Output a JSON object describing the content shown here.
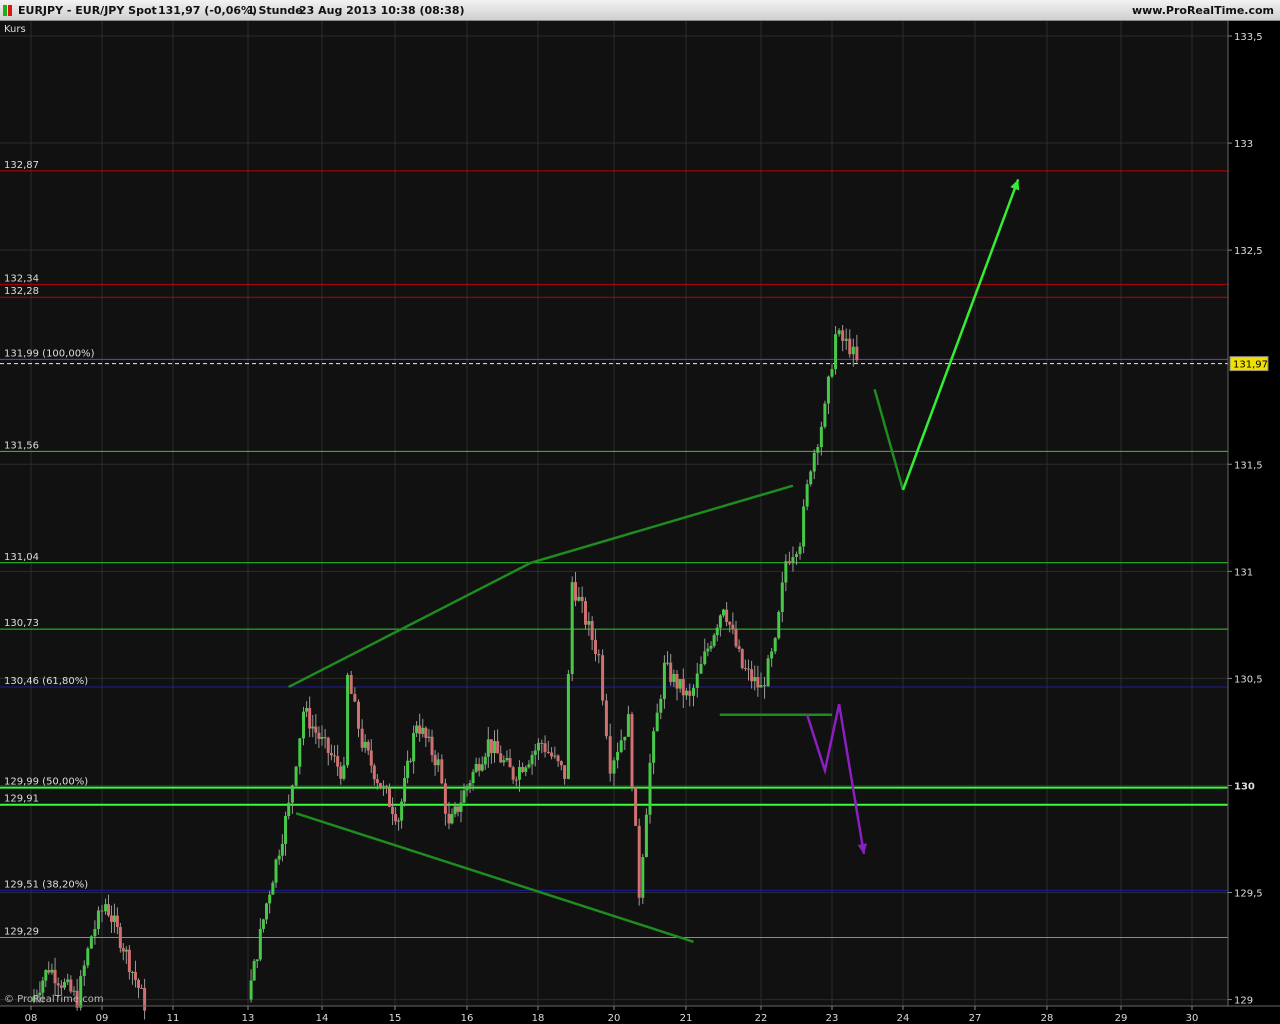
{
  "header": {
    "instrument": "EURJPY - EUR/JPY Spot",
    "quote": "131,97 (-0,06%)",
    "period": "1 Stunde",
    "datetime": "23 Aug 2013 10:38 (08:38)",
    "website": "www.ProRealTime.com",
    "indicator_colors": [
      "#19b319",
      "#e01414"
    ]
  },
  "chart_data": {
    "type": "candlestick",
    "title": "Kurs",
    "watermark": "© ProRealTime.com",
    "ylim": [
      128.97,
      133.57
    ],
    "y_ticks": [
      "133,5",
      "133",
      "132,5",
      "131,5",
      "131",
      "130,5",
      "130",
      "129,5",
      "129"
    ],
    "x_ticks": [
      {
        "label": "08",
        "x": 0
      },
      {
        "label": "09",
        "x": 1
      },
      {
        "label": "11",
        "x": 2
      },
      {
        "label": "13",
        "x": 3
      },
      {
        "label": "14",
        "x": 4
      },
      {
        "label": "15",
        "x": 5
      },
      {
        "label": "16",
        "x": 6
      },
      {
        "label": "18",
        "x": 7
      },
      {
        "label": "20",
        "x": 8
      },
      {
        "label": "21",
        "x": 9
      },
      {
        "label": "22",
        "x": 10
      },
      {
        "label": "23",
        "x": 11
      },
      {
        "label": "24",
        "x": 12
      },
      {
        "label": "27",
        "x": 13
      },
      {
        "label": "28",
        "x": 14
      },
      {
        "label": "29",
        "x": 15
      },
      {
        "label": "30",
        "x": 16
      }
    ],
    "current_price": {
      "value": 131.97,
      "label": "131,97",
      "color": "#f0e000"
    },
    "hlines": [
      {
        "value": 132.87,
        "label": "132,87",
        "color": "#c00000",
        "width": 1
      },
      {
        "value": 132.34,
        "label": "132,34",
        "color": "#c00000",
        "width": 1
      },
      {
        "value": 132.28,
        "label": "132,28",
        "color": "#c00000",
        "width": 1
      },
      {
        "value": 131.99,
        "label": "131,99 (100,00%)",
        "color": "#8a2be2",
        "width": 1
      },
      {
        "value": 131.56,
        "label": "131,56",
        "color": "#2ecc2e",
        "width": 1
      },
      {
        "value": 131.04,
        "label": "131,04",
        "color": "#2ecc2e",
        "width": 1
      },
      {
        "value": 130.73,
        "label": "130,73",
        "color": "#2ecc2e",
        "width": 1
      },
      {
        "value": 130.46,
        "label": "130,46 (61,80%)",
        "color": "#1c1ca0",
        "width": 1
      },
      {
        "value": 129.99,
        "label": "129,99 (50,00%)",
        "color": "#35ff35",
        "width": 2
      },
      {
        "value": 129.91,
        "label": "129,91",
        "color": "#35ff35",
        "width": 2
      },
      {
        "value": 129.51,
        "label": "129,51 (38,20%)",
        "color": "#1c1ca0",
        "width": 1
      },
      {
        "value": 129.29,
        "label": "129,29",
        "color": "#2ecc2e",
        "width": 1
      }
    ],
    "bold_tick": "130",
    "price_path": [
      [
        0.0,
        128.99
      ],
      [
        0.25,
        129.15
      ],
      [
        0.65,
        129.0
      ],
      [
        0.85,
        129.3
      ],
      [
        1.05,
        129.45
      ],
      [
        1.3,
        129.25
      ],
      [
        1.6,
        128.98
      ],
      [
        3.0,
        129.0
      ],
      [
        3.25,
        129.45
      ],
      [
        3.55,
        129.9
      ],
      [
        3.75,
        130.35
      ],
      [
        4.0,
        130.2
      ],
      [
        4.3,
        130.05
      ],
      [
        4.35,
        130.5
      ],
      [
        4.55,
        130.2
      ],
      [
        4.8,
        130.0
      ],
      [
        5.05,
        129.85
      ],
      [
        5.3,
        130.3
      ],
      [
        5.6,
        130.1
      ],
      [
        5.75,
        129.8
      ],
      [
        6.0,
        130.0
      ],
      [
        6.3,
        130.2
      ],
      [
        6.65,
        130.05
      ],
      [
        7.05,
        130.2
      ],
      [
        7.35,
        130.05
      ],
      [
        7.45,
        130.95
      ],
      [
        7.8,
        130.6
      ],
      [
        7.95,
        130.1
      ],
      [
        8.2,
        130.3
      ],
      [
        8.35,
        129.5
      ],
      [
        8.5,
        130.1
      ],
      [
        8.7,
        130.55
      ],
      [
        9.05,
        130.4
      ],
      [
        9.25,
        130.6
      ],
      [
        9.5,
        130.85
      ],
      [
        9.75,
        130.55
      ],
      [
        10.0,
        130.45
      ],
      [
        10.2,
        130.65
      ],
      [
        10.35,
        131.05
      ],
      [
        10.55,
        131.15
      ],
      [
        10.7,
        131.5
      ],
      [
        10.9,
        131.75
      ],
      [
        11.05,
        132.1
      ],
      [
        11.25,
        132.05
      ],
      [
        11.35,
        131.97
      ]
    ],
    "drawings": [
      {
        "kind": "trend",
        "color": "#1e8c1e",
        "points": [
          [
            3.55,
            130.46
          ],
          [
            6.9,
            131.04
          ],
          [
            10.45,
            131.4
          ]
        ]
      },
      {
        "kind": "trend",
        "color": "#1e8c1e",
        "points": [
          [
            3.65,
            129.87
          ],
          [
            9.1,
            129.27
          ]
        ]
      },
      {
        "kind": "segment",
        "color": "#1e8c1e",
        "points": [
          [
            9.45,
            130.33
          ],
          [
            11.0,
            130.33
          ]
        ]
      },
      {
        "kind": "zigzag",
        "color": "#1e8c1e",
        "points": [
          [
            11.6,
            131.85
          ],
          [
            12.0,
            131.38
          ]
        ]
      },
      {
        "kind": "arrow",
        "color": "#33ee33",
        "points": [
          [
            12.0,
            131.38
          ],
          [
            13.6,
            132.83
          ]
        ]
      },
      {
        "kind": "zigzag",
        "color": "#8b1fbf",
        "points": [
          [
            10.65,
            130.33
          ],
          [
            10.9,
            130.07
          ],
          [
            11.1,
            130.38
          ]
        ]
      },
      {
        "kind": "arrow",
        "color": "#8b1fbf",
        "points": [
          [
            11.1,
            130.38
          ],
          [
            11.45,
            129.68
          ]
        ]
      }
    ]
  }
}
